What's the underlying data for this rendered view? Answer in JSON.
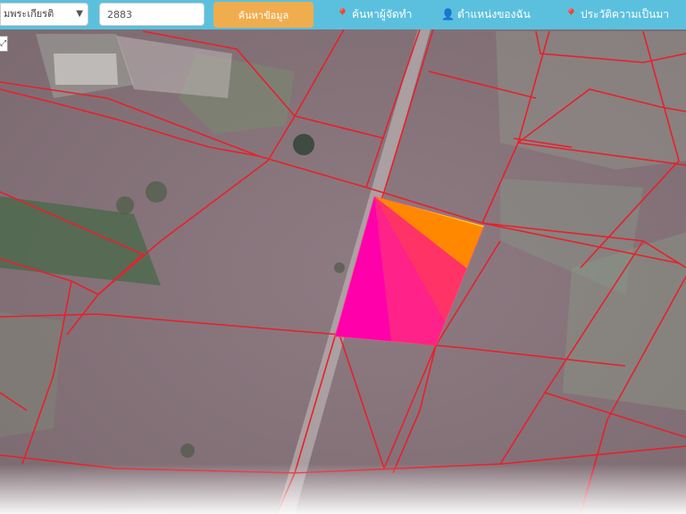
{
  "toolbar": {
    "province_select_value": "มพระเกียรติ",
    "parcel_number_value": "2883",
    "search_button_label": "ค้นหาข้อมูล",
    "links": [
      {
        "icon": "pin-icon",
        "glyph": "📍",
        "label": "ค้นหาผู้จัดทำ"
      },
      {
        "icon": "user-icon",
        "glyph": "👤",
        "label": "ตำแหน่งของฉัน"
      },
      {
        "icon": "info-icon",
        "glyph": "📍",
        "label": "ประวัติความเป็นมา"
      }
    ]
  },
  "map": {
    "type": "satellite",
    "zoom_control_glyph": "⤢",
    "colors": {
      "parcel_boundary": "#e8202a",
      "highlight_gradient": [
        "#ff00cc",
        "#ff3366",
        "#ff8800",
        "#ffee00",
        "#88ff00",
        "#00ffcc",
        "#0066ff"
      ]
    }
  }
}
